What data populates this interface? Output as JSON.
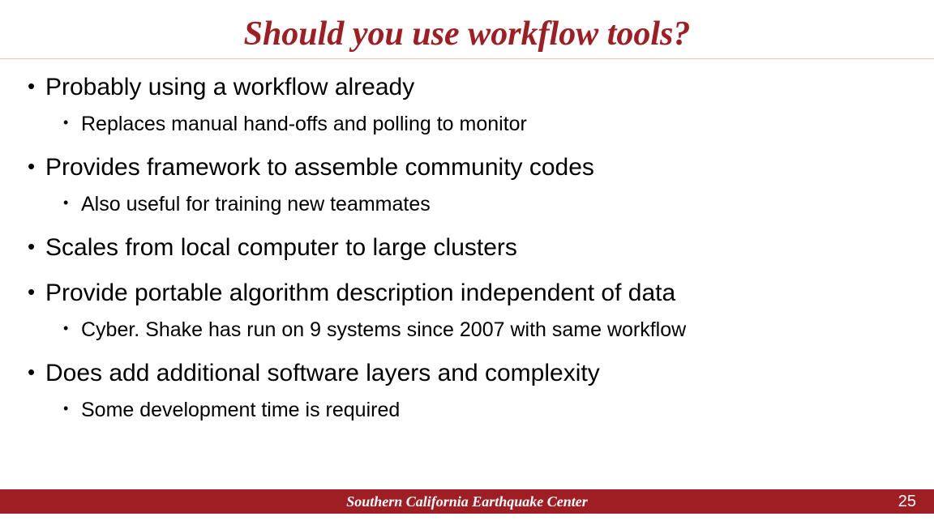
{
  "title": "Should you use workflow tools?",
  "bullets": [
    {
      "text": "Probably using a workflow already",
      "sub": [
        "Replaces manual hand-offs and polling to monitor"
      ]
    },
    {
      "text": "Provides framework to assemble community codes",
      "sub": [
        "Also useful for training new teammates"
      ]
    },
    {
      "text": "Scales from local computer to large clusters",
      "sub": []
    },
    {
      "text": "Provide portable algorithm description independent of data",
      "sub": [
        "Cyber. Shake has run on 9 systems since 2007 with same workflow"
      ]
    },
    {
      "text": "Does add additional software layers and complexity",
      "sub": [
        "Some development time is required"
      ]
    }
  ],
  "footer": {
    "org": "Southern California Earthquake Center",
    "page": "25"
  }
}
